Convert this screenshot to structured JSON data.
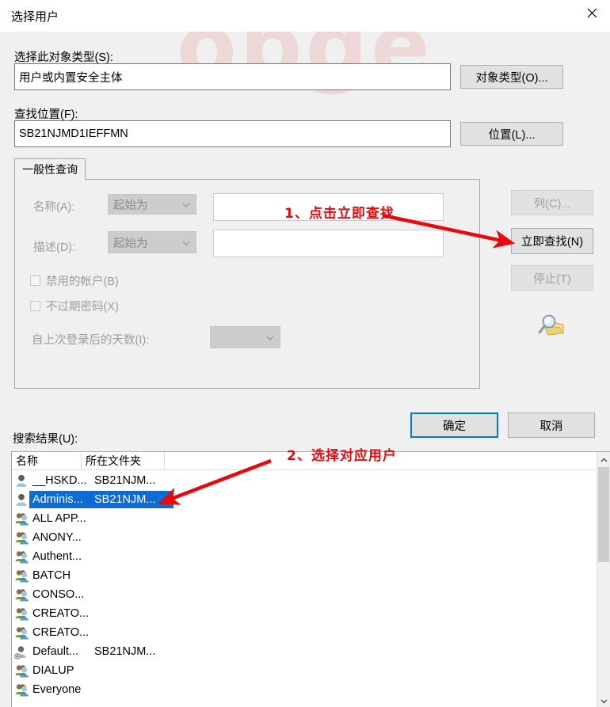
{
  "window": {
    "title": "选择用户",
    "close_icon": "close-icon",
    "watermark": "obge"
  },
  "object_type": {
    "label": "选择此对象类型(S):",
    "value": "用户或内置安全主体",
    "button": "对象类型(O)..."
  },
  "location": {
    "label": "查找位置(F):",
    "value": "SB21NJMD1IEFFMN",
    "button": "位置(L)..."
  },
  "query_panel": {
    "tab": "一般性查询",
    "name": {
      "label": "名称(A):",
      "condition": "起始为",
      "value": ""
    },
    "description": {
      "label": "描述(D):",
      "condition": "起始为",
      "value": ""
    },
    "disabled_accounts": {
      "label": "禁用的帐户(B)",
      "checked": false
    },
    "non_expiring_password": {
      "label": "不过期密码(X)",
      "checked": false
    },
    "days_since_logon": {
      "label": "自上次登录后的天数(I):",
      "value": ""
    },
    "buttons": {
      "columns": "列(C)...",
      "find_now": "立即查找(N)",
      "stop": "停止(T)"
    },
    "search_icon": "search-magnifier-icon"
  },
  "dialog_buttons": {
    "ok": "确定",
    "cancel": "取消"
  },
  "results": {
    "label": "搜索结果(U):",
    "columns": [
      "名称",
      "所在文件夹",
      ""
    ],
    "rows": [
      {
        "name": "__HSKD...",
        "folder": "SB21NJM...",
        "icon": "user-icon",
        "selected": false
      },
      {
        "name": "Adminis...",
        "folder": "SB21NJM...",
        "icon": "user-icon",
        "selected": true
      },
      {
        "name": "ALL APP...",
        "folder": "",
        "icon": "group-icon",
        "selected": false
      },
      {
        "name": "ANONY...",
        "folder": "",
        "icon": "group-icon",
        "selected": false
      },
      {
        "name": "Authent...",
        "folder": "",
        "icon": "group-icon",
        "selected": false
      },
      {
        "name": "BATCH",
        "folder": "",
        "icon": "group-icon",
        "selected": false
      },
      {
        "name": "CONSO...",
        "folder": "",
        "icon": "group-icon",
        "selected": false
      },
      {
        "name": "CREATO...",
        "folder": "",
        "icon": "group-icon",
        "selected": false
      },
      {
        "name": "CREATO...",
        "folder": "",
        "icon": "group-icon",
        "selected": false
      },
      {
        "name": "Default...",
        "folder": "SB21NJM...",
        "icon": "user-disabled-icon",
        "selected": false
      },
      {
        "name": "DIALUP",
        "folder": "",
        "icon": "group-icon",
        "selected": false
      },
      {
        "name": "Everyone",
        "folder": "",
        "icon": "group-icon",
        "selected": false
      }
    ],
    "scrollbar": {
      "up_icon": "chevron-up-icon",
      "down_icon": "chevron-down-icon"
    }
  },
  "annotations": [
    {
      "text": "1、点击立即查找",
      "color": "#e8090f"
    },
    {
      "text": "2、选择对应用户",
      "color": "#e8090f"
    }
  ]
}
